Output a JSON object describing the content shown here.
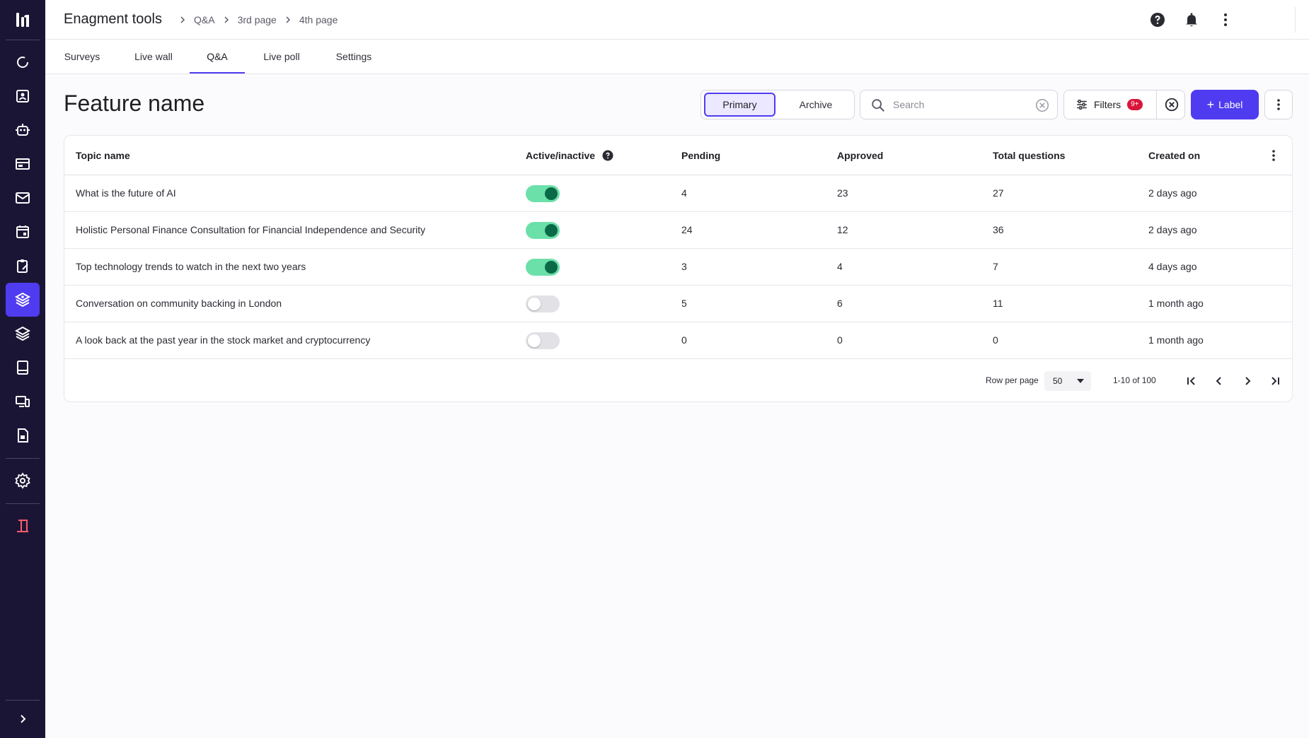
{
  "header": {
    "app_title": "Enagment tools",
    "breadcrumbs": [
      "Q&A",
      "3rd page",
      "4th page"
    ]
  },
  "tabs": [
    {
      "label": "Surveys",
      "active": false
    },
    {
      "label": "Live wall",
      "active": false
    },
    {
      "label": "Q&A",
      "active": true
    },
    {
      "label": "Live poll",
      "active": false
    },
    {
      "label": "Settings",
      "active": false
    }
  ],
  "page": {
    "title": "Feature name"
  },
  "toolbar": {
    "segment_primary": "Primary",
    "segment_archive": "Archive",
    "search_placeholder": "Search",
    "filters_label": "Filters",
    "filters_badge": "9+",
    "add_label": "Label"
  },
  "table": {
    "headers": {
      "topic": "Topic name",
      "active": "Active/inactive",
      "pending": "Pending",
      "approved": "Approved",
      "total": "Total questions",
      "created": "Created on"
    },
    "rows": [
      {
        "topic": "What is the future of AI",
        "active": true,
        "pending": "4",
        "approved": "23",
        "total": "27",
        "created": "2 days ago"
      },
      {
        "topic": "Holistic Personal Finance Consultation for Financial Independence and Security",
        "active": true,
        "pending": "24",
        "approved": "12",
        "total": "36",
        "created": "2 days ago"
      },
      {
        "topic": "Top technology trends to watch in the next two years",
        "active": true,
        "pending": "3",
        "approved": "4",
        "total": "7",
        "created": "4 days ago"
      },
      {
        "topic": "Conversation on community backing in London",
        "active": false,
        "pending": "5",
        "approved": "6",
        "total": "11",
        "created": "1 month ago"
      },
      {
        "topic": "A look back at the past year in the stock market and cryptocurrency",
        "active": false,
        "pending": "0",
        "approved": "0",
        "total": "0",
        "created": "1 month ago"
      }
    ]
  },
  "pagination": {
    "rows_per_page_label": "Row per page",
    "rows_per_page": "50",
    "range": "1-10 of 100"
  },
  "colors": {
    "accent": "#4f3cf0",
    "sidebar_bg": "#1b1535",
    "toggle_on": "#6be0a8",
    "badge": "#d9163a"
  }
}
